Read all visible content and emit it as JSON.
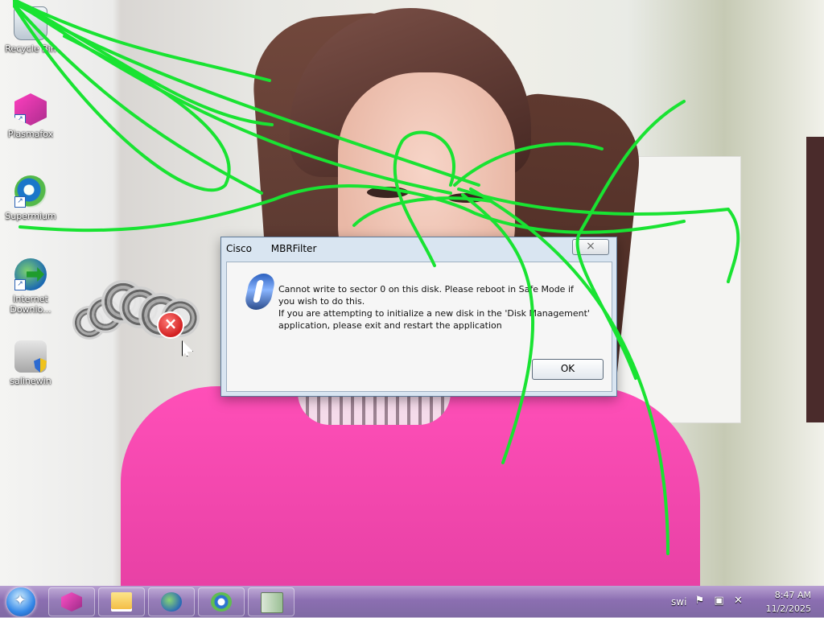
{
  "desktop": {
    "icons": [
      {
        "label": "Recycle Bin",
        "icon": "recycle-bin-icon"
      },
      {
        "label": "Plasmafox",
        "icon": "plasmafox-icon"
      },
      {
        "label": "Supermium",
        "icon": "supermium-icon"
      },
      {
        "label": "Internet Downlo...",
        "icon": "internet-download-manager-icon"
      },
      {
        "label": "salinewin",
        "icon": "salinewin-icon"
      }
    ]
  },
  "dialog": {
    "title_app": "Cisco",
    "title_text": "MBRFilter",
    "message_line1": "Cannot write to sector 0 on this disk. Please reboot in Safe Mode if you wish to do this.",
    "message_line2": "If you are attempting to initialize a new disk in the 'Disk Management' application, please exit and restart the application",
    "ok_label": "OK",
    "close_label": "×"
  },
  "taskbar": {
    "items": [
      "start",
      "plasmafox",
      "file-explorer",
      "internet-download-manager",
      "supermium",
      "salinewin"
    ],
    "tray": {
      "text": "swi",
      "time": "8:47 AM",
      "date": "11/2/2025"
    }
  },
  "colors": {
    "taskbar": "#8b6eb1",
    "scribble": "#19e332",
    "shirt": "#ff4fb8"
  }
}
